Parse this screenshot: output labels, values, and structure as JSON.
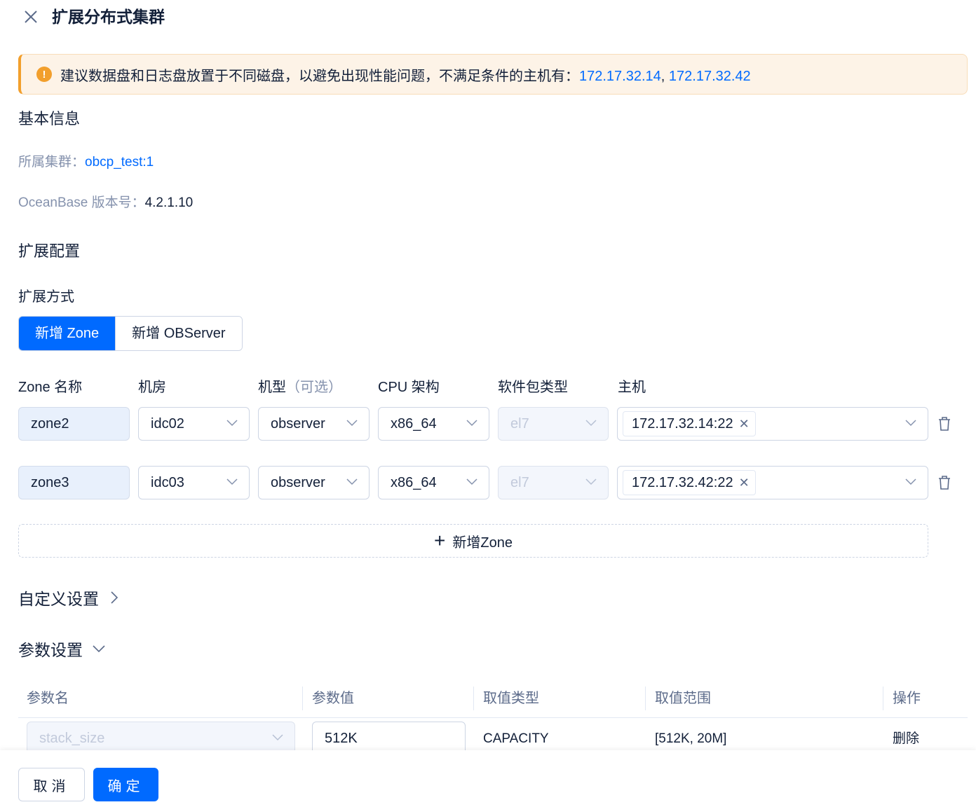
{
  "header": {
    "title": "扩展分布式集群"
  },
  "alert": {
    "message": "建议数据盘和日志盘放置于不同磁盘，以避免出现性能问题，不满足条件的主机有：",
    "host1": "172.17.32.14",
    "separator": ",",
    "host2": "172.17.32.42",
    "color": "#f29f2c"
  },
  "basic_info": {
    "section_title": "基本信息",
    "cluster_label": "所属集群：",
    "cluster_value": "obcp_test:1",
    "version_label": "OceanBase 版本号：",
    "version_value": "4.2.1.10"
  },
  "expand_config": {
    "section_title": "扩展配置",
    "mode_label": "扩展方式",
    "mode_options": [
      "新增 Zone",
      "新增 OBServer"
    ],
    "selected_mode": "新增 Zone",
    "accent_color": "#006aff"
  },
  "zone_table": {
    "columns": [
      "Zone 名称",
      "机房",
      "机型",
      "（可选）",
      "CPU 架构",
      "软件包类型",
      "主机"
    ],
    "rows": [
      {
        "zone": "zone2",
        "idc": "idc02",
        "model": "observer",
        "cpu": "x86_64",
        "pkg": "el7",
        "host": "172.17.32.14:22"
      },
      {
        "zone": "zone3",
        "idc": "idc03",
        "model": "observer",
        "cpu": "x86_64",
        "pkg": "el7",
        "host": "172.17.32.42:22"
      }
    ],
    "add_label": "新增Zone"
  },
  "custom_settings": {
    "title": "自定义设置"
  },
  "param_settings": {
    "title": "参数设置",
    "columns": [
      "参数名",
      "参数值",
      "取值类型",
      "取值范围",
      "操作"
    ],
    "rows": [
      {
        "name": "stack_size",
        "value": "512K",
        "type": "CAPACITY",
        "range": "[512K, 20M]",
        "action": "删除"
      }
    ]
  },
  "footer": {
    "cancel_label": "取消",
    "confirm_label": "确定"
  }
}
